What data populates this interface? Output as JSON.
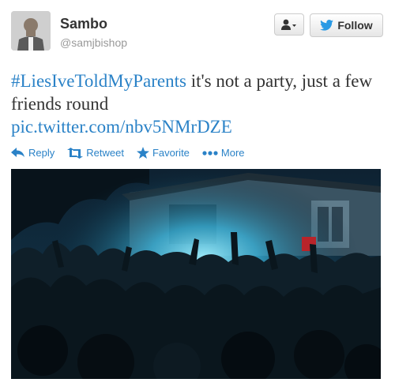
{
  "user": {
    "name": "Sambo",
    "handle": "@samjbishop"
  },
  "buttons": {
    "follow_label": "Follow"
  },
  "tweet": {
    "hashtag": "#LiesIveToldMyParents",
    "text": " it's not a party, just a few friends round",
    "link": "pic.twitter.com/nbv5NMrDZE"
  },
  "actions": {
    "reply": "Reply",
    "retweet": "Retweet",
    "favorite": "Favorite",
    "more": "More"
  },
  "colors": {
    "link": "#2a82c7",
    "twitter_blue": "#2a9ae4"
  }
}
